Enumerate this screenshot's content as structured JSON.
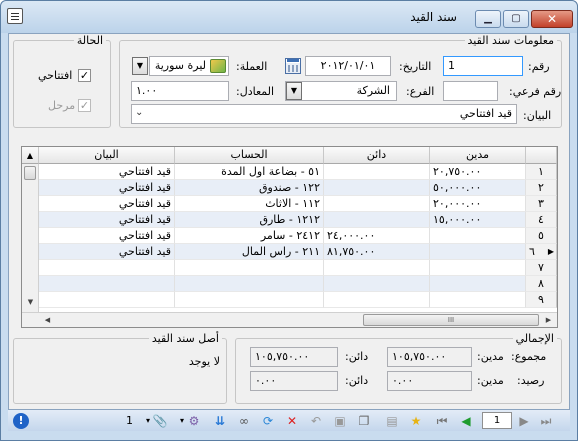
{
  "window": {
    "title": "سند القيد"
  },
  "info_group": {
    "legend": "معلومات سند القيد",
    "number_label": "رقم:",
    "number_value": "1",
    "date_label": "التاريخ:",
    "date_value": "٢٠١٢/٠١/٠١",
    "currency_label": "العملة:",
    "currency_value": "ليرة سورية",
    "sub_number_label": "رقم فرعي:",
    "sub_number_value": "",
    "branch_label": "الفرع:",
    "branch_value": "الشركة",
    "rate_label": "المعادل:",
    "rate_value": "١.٠٠",
    "statement_label": "البيان:",
    "statement_value": "قيد افتتاحي"
  },
  "status_group": {
    "legend": "الحالة",
    "opening_label": "افتتاحي",
    "opening_checked": true,
    "posted_label": "مرحل",
    "posted_checked": true
  },
  "grid": {
    "columns": [
      "مدين",
      "دائن",
      "الحساب",
      "البيان"
    ],
    "rows": [
      {
        "n": "١",
        "debit": "٢٠,٧٥٠.٠٠",
        "credit": "",
        "account": "٥١ - بضاعة اول المدة",
        "note": "قيد افتتاحي"
      },
      {
        "n": "٢",
        "debit": "٥٠,٠٠٠.٠٠",
        "credit": "",
        "account": "١٢٢ - صندوق",
        "note": "قيد افتتاحي"
      },
      {
        "n": "٣",
        "debit": "٢٠,٠٠٠.٠٠",
        "credit": "",
        "account": "١١٢ - الاثاث",
        "note": "قيد افتتاحي"
      },
      {
        "n": "٤",
        "debit": "١٥,٠٠٠.٠٠",
        "credit": "",
        "account": "١٢١٢ - طارق",
        "note": "قيد افتتاحي"
      },
      {
        "n": "٥",
        "debit": "",
        "credit": "٢٤,٠٠٠.٠٠",
        "account": "٢٤١٢ - سامر",
        "note": "قيد افتتاحي"
      },
      {
        "n": "٦",
        "debit": "",
        "credit": "٨١,٧٥٠.٠٠",
        "account": "٢١١ - راس المال",
        "note": "قيد افتتاحي"
      },
      {
        "n": "٧",
        "debit": "",
        "credit": "",
        "account": "",
        "note": ""
      },
      {
        "n": "٨",
        "debit": "",
        "credit": "",
        "account": "",
        "note": ""
      },
      {
        "n": "٩",
        "debit": "",
        "credit": "",
        "account": "",
        "note": ""
      }
    ],
    "scroll_marker": "III"
  },
  "totals": {
    "legend": "الإجمالي",
    "sum_label": "مجموع:",
    "balance_label": "رصيد:",
    "debit_label": "مدين:",
    "credit_label": "دائن:",
    "sum_debit": "١٠٥,٧٥٠.٠٠",
    "sum_credit": "١٠٥,٧٥٠.٠٠",
    "balance_debit": "٠.٠٠",
    "balance_credit": "٠.٠٠"
  },
  "origin": {
    "legend": "أصل سند القيد",
    "value": "لا يوجد"
  },
  "toolbar": {
    "page_value": "1",
    "count_value": "1"
  }
}
